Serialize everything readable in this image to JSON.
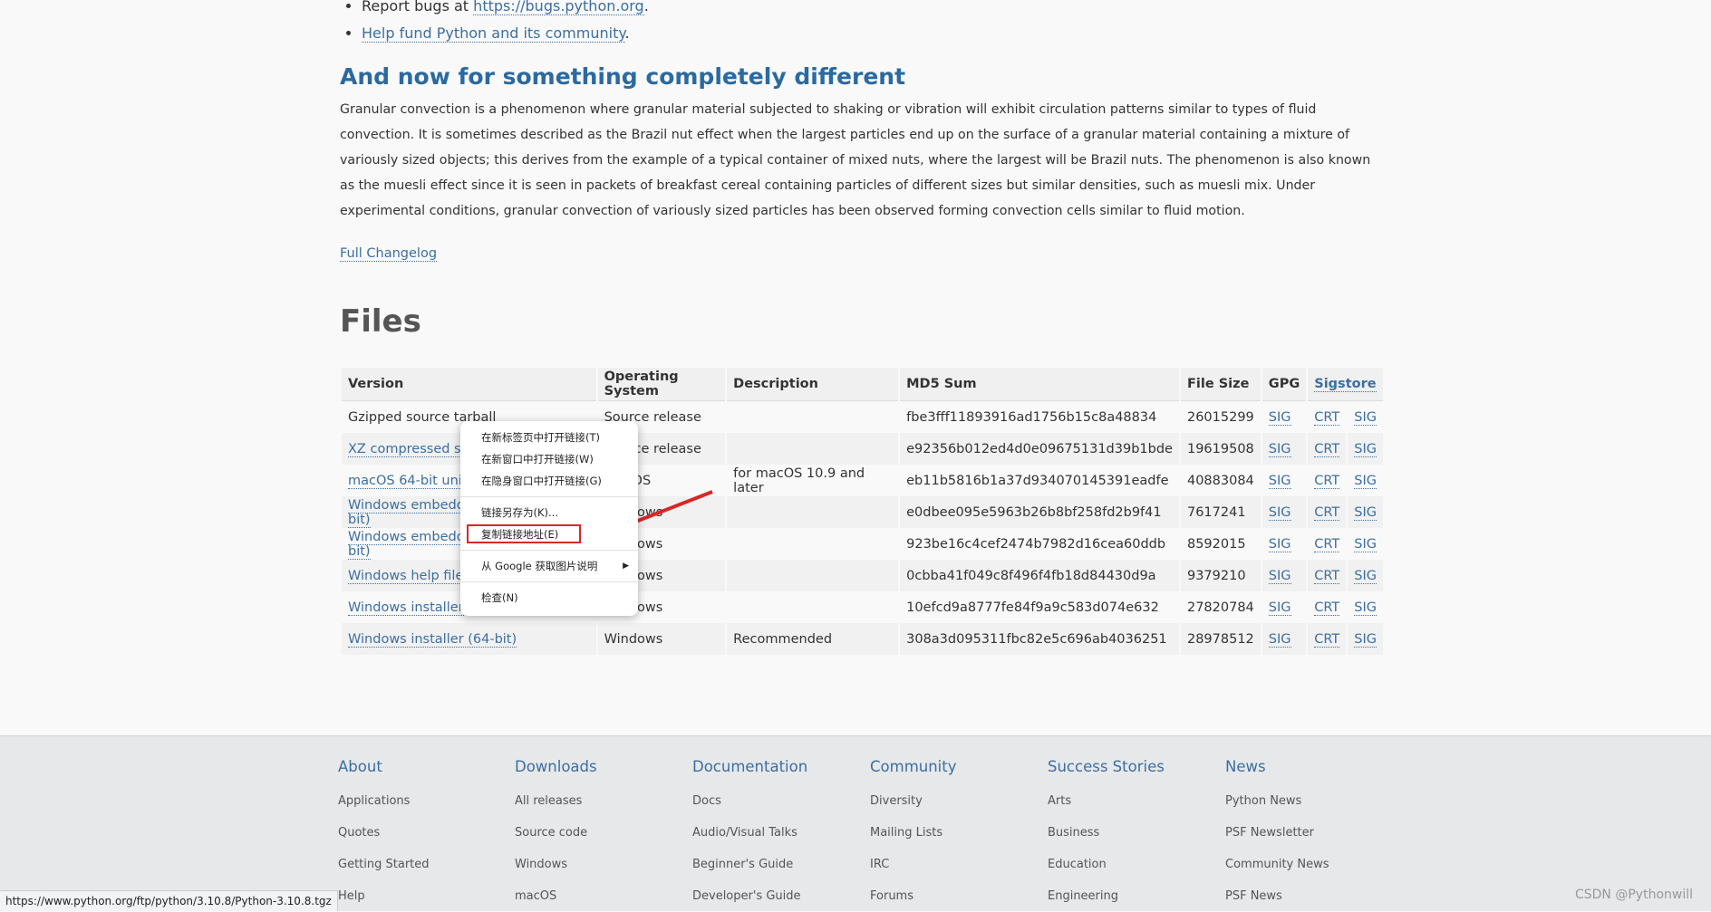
{
  "bullets": [
    {
      "prefix": "Report bugs at ",
      "link": "https://bugs.python.org",
      "suffix": "."
    },
    {
      "prefix": "",
      "link": "Help fund Python and its community",
      "suffix": "."
    }
  ],
  "section": {
    "title": "And now for something completely different",
    "paragraph": "Granular convection is a phenomenon where granular material subjected to shaking or vibration will exhibit circulation patterns similar to types of fluid convection. It is sometimes described as the Brazil nut effect when the largest particles end up on the surface of a granular material containing a mixture of variously sized objects; this derives from the example of a typical container of mixed nuts, where the largest will be Brazil nuts. The phenomenon is also known as the muesli effect since it is seen in packets of breakfast cereal containing particles of different sizes but similar densities, such as muesli mix. Under experimental conditions, granular convection of variously sized particles has been observed forming convection cells similar to fluid motion.",
    "changelog": "Full Changelog"
  },
  "files": {
    "title": "Files",
    "headers": [
      "Version",
      "Operating System",
      "Description",
      "MD5 Sum",
      "File Size",
      "GPG",
      "Sigstore"
    ],
    "rows": [
      {
        "version": "Gzipped source tarball",
        "version_is_link": false,
        "os": "Source release",
        "desc": "",
        "md5": "fbe3fff11893916ad1756b15c8a48834",
        "size": "26015299",
        "gpg": "SIG",
        "crt": "CRT",
        "sig": "SIG"
      },
      {
        "version": "XZ compressed source tarball",
        "version_is_link": true,
        "os": "Source release",
        "desc": "",
        "md5": "e92356b012ed4d0e09675131d39b1bde",
        "size": "19619508",
        "gpg": "SIG",
        "crt": "CRT",
        "sig": "SIG"
      },
      {
        "version": "macOS 64-bit universal2 installer",
        "version_is_link": true,
        "os": "macOS",
        "desc": "for macOS 10.9 and later",
        "md5": "eb11b5816b1a37d934070145391eadfe",
        "size": "40883084",
        "gpg": "SIG",
        "crt": "CRT",
        "sig": "SIG"
      },
      {
        "version": "Windows embeddable package (32-bit)",
        "version_is_link": true,
        "os": "Windows",
        "desc": "",
        "md5": "e0dbee095e5963b26b8bf258fd2b9f41",
        "size": "7617241",
        "gpg": "SIG",
        "crt": "CRT",
        "sig": "SIG"
      },
      {
        "version": "Windows embeddable package (64-bit)",
        "version_is_link": true,
        "os": "Windows",
        "desc": "",
        "md5": "923be16c4cef2474b7982d16cea60ddb",
        "size": "8592015",
        "gpg": "SIG",
        "crt": "CRT",
        "sig": "SIG"
      },
      {
        "version": "Windows help file",
        "version_is_link": true,
        "os": "Windows",
        "desc": "",
        "md5": "0cbba41f049c8f496f4fb18d84430d9a",
        "size": "9379210",
        "gpg": "SIG",
        "crt": "CRT",
        "sig": "SIG"
      },
      {
        "version": "Windows installer (32-bit)",
        "version_is_link": true,
        "os": "Windows",
        "desc": "",
        "md5": "10efcd9a8777fe84f9a9c583d074e632",
        "size": "27820784",
        "gpg": "SIG",
        "crt": "CRT",
        "sig": "SIG"
      },
      {
        "version": "Windows installer (64-bit)",
        "version_is_link": true,
        "os": "Windows",
        "desc": "Recommended",
        "md5": "308a3d095311fbc82e5c696ab4036251",
        "size": "28978512",
        "gpg": "SIG",
        "crt": "CRT",
        "sig": "SIG"
      }
    ]
  },
  "context_menu": {
    "items": [
      {
        "label": "在新标签页中打开链接(T)",
        "group": 1
      },
      {
        "label": "在新窗口中打开链接(W)",
        "group": 1
      },
      {
        "label": "在隐身窗口中打开链接(G)",
        "group": 1
      },
      {
        "label": "链接另存为(K)...",
        "group": 2
      },
      {
        "label": "复制链接地址(E)",
        "group": 2,
        "highlighted": true
      },
      {
        "label": "从 Google 获取图片说明",
        "group": 3,
        "submenu": true
      },
      {
        "label": "检查(N)",
        "group": 4
      }
    ]
  },
  "footer": {
    "columns": [
      {
        "title": "About",
        "links": [
          "Applications",
          "Quotes",
          "Getting Started",
          "Help"
        ]
      },
      {
        "title": "Downloads",
        "links": [
          "All releases",
          "Source code",
          "Windows",
          "macOS"
        ]
      },
      {
        "title": "Documentation",
        "links": [
          "Docs",
          "Audio/Visual Talks",
          "Beginner's Guide",
          "Developer's Guide"
        ]
      },
      {
        "title": "Community",
        "links": [
          "Diversity",
          "Mailing Lists",
          "IRC",
          "Forums"
        ]
      },
      {
        "title": "Success Stories",
        "links": [
          "Arts",
          "Business",
          "Education",
          "Engineering"
        ]
      },
      {
        "title": "News",
        "links": [
          "Python News",
          "PSF Newsletter",
          "Community News",
          "PSF News"
        ]
      }
    ]
  },
  "status_bar": "https://www.python.org/ftp/python/3.10.8/Python-3.10.8.tgz",
  "watermark": "CSDN @Pythonwill",
  "colors": {
    "link": "#3c6ea1",
    "annotation": "#d92626"
  }
}
